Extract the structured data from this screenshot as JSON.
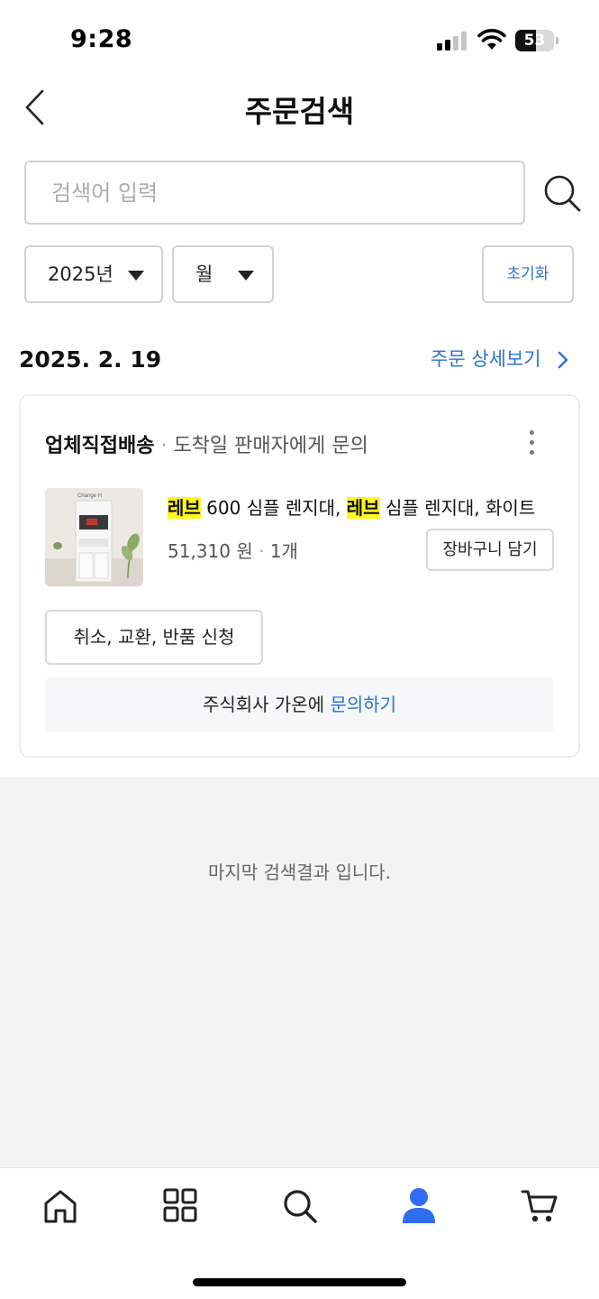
{
  "status_bar": {
    "time": "9:28",
    "battery": "53",
    "battery_level": 0.53
  },
  "header": {
    "title": "주문검색"
  },
  "search": {
    "placeholder": "검색어 입력",
    "value": ""
  },
  "filters": {
    "year": "2025년",
    "month": "월",
    "reset_label": "초기화"
  },
  "order": {
    "date": "2025. 2. 19",
    "detail_link": "주문 상세보기",
    "shipping_type": "업체직접배송",
    "shipping_separator": " · ",
    "shipping_info": "도착일 판매자에게 문의",
    "product": {
      "name_parts": {
        "h1": "레브",
        "t1": " 600 심플 렌지대, ",
        "h2": "레브",
        "t2": " 심플 렌지대, 화이트"
      },
      "price": "51,310 원",
      "price_separator": " · ",
      "quantity": "1개",
      "thumbnail_icon": "product-thumbnail",
      "thumbnail_caption": "Change H"
    },
    "cart_button": "장바구니 담기",
    "cancel_button": "취소, 교환, 반품 신청",
    "inquiry_prefix": "주식회사 가온에 ",
    "inquiry_link": "문의하기"
  },
  "end_message": "마지막 검색결과 입니다.",
  "tab_bar": {
    "items": [
      {
        "icon": "home-icon",
        "active": false
      },
      {
        "icon": "grid-icon",
        "active": false
      },
      {
        "icon": "search-icon",
        "active": false
      },
      {
        "icon": "person-icon",
        "active": true
      },
      {
        "icon": "cart-icon",
        "active": false
      }
    ]
  },
  "colors": {
    "accent": "#2d6fd6",
    "highlight": "#fff71a",
    "active_tab": "#2f6df0"
  }
}
